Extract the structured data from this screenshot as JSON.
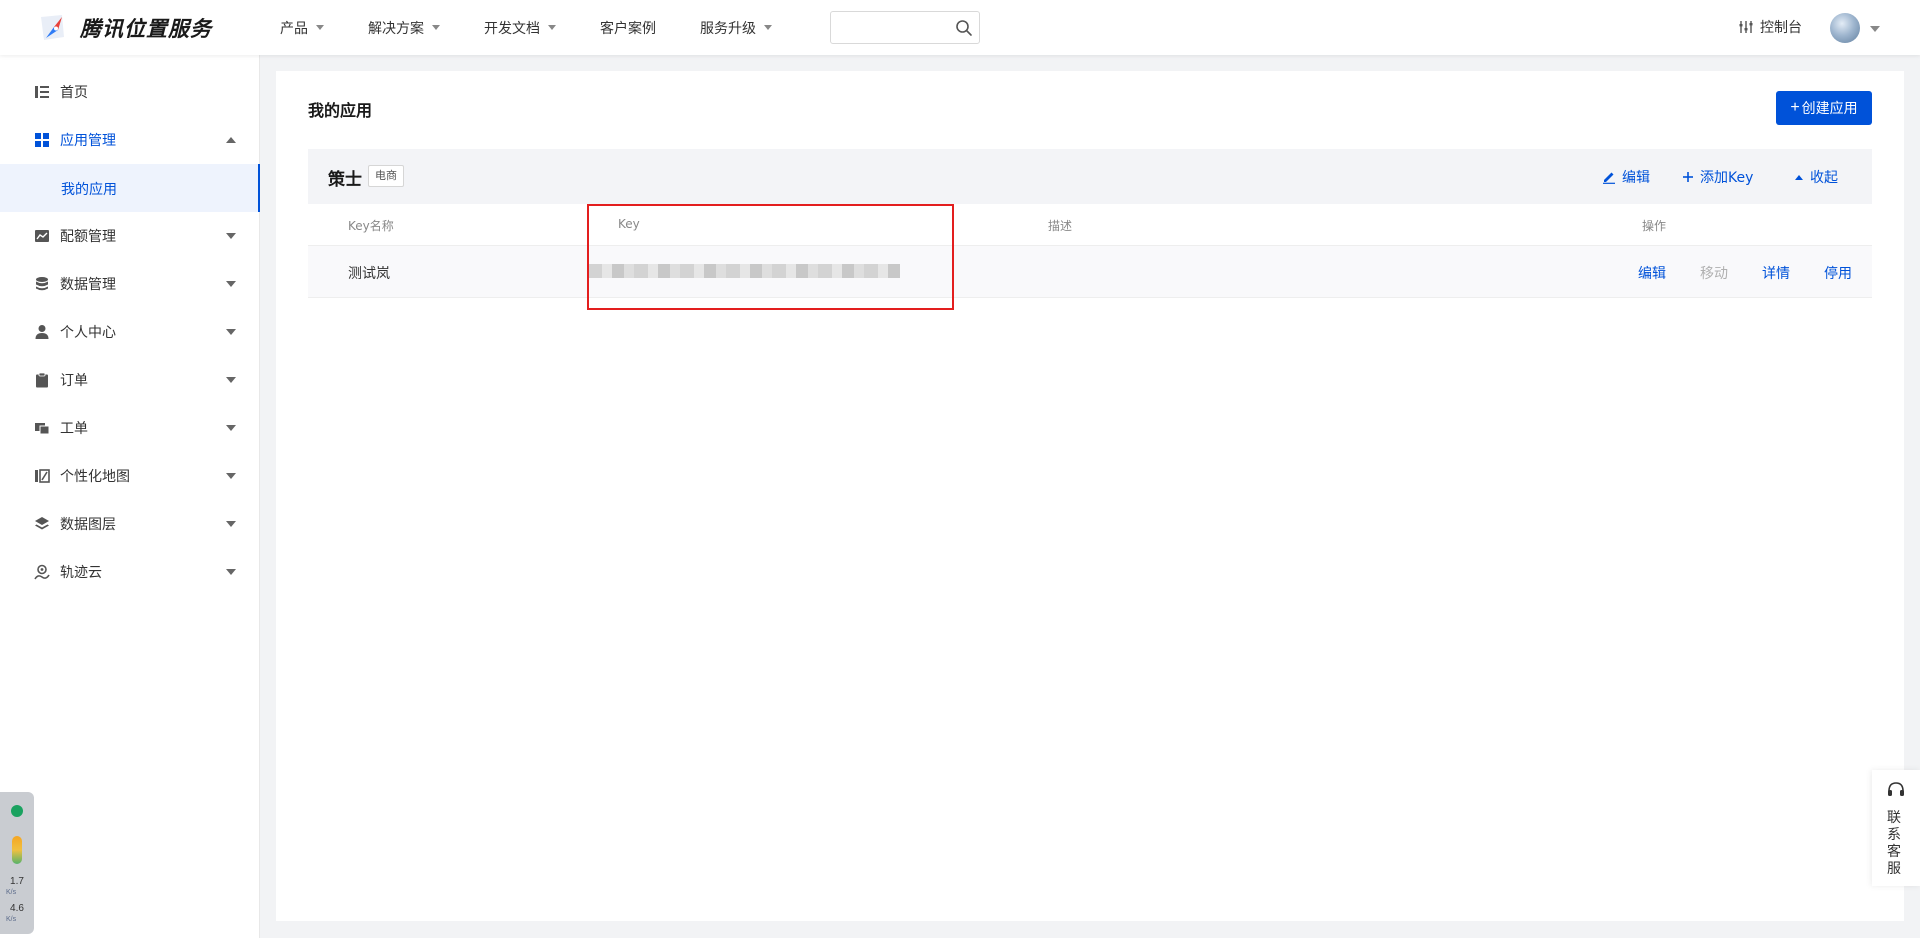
{
  "header": {
    "logo_text": "腾讯位置服务",
    "nav": [
      {
        "label": "产品",
        "has_caret": true
      },
      {
        "label": "解决方案",
        "has_caret": true
      },
      {
        "label": "开发文档",
        "has_caret": true
      },
      {
        "label": "客户案例",
        "has_caret": false
      },
      {
        "label": "服务升级",
        "has_caret": true
      }
    ],
    "search_value": "",
    "console_label": "控制台"
  },
  "sidebar": {
    "items": [
      {
        "label": "首页",
        "icon": "list-icon",
        "arrow": "none"
      },
      {
        "label": "应用管理",
        "icon": "grid-icon",
        "arrow": "up",
        "active": true
      },
      {
        "label": "配额管理",
        "icon": "chart-icon",
        "arrow": "down"
      },
      {
        "label": "数据管理",
        "icon": "database-icon",
        "arrow": "down"
      },
      {
        "label": "个人中心",
        "icon": "user-icon",
        "arrow": "down"
      },
      {
        "label": "订单",
        "icon": "clipboard-icon",
        "arrow": "down"
      },
      {
        "label": "工单",
        "icon": "ticket-icon",
        "arrow": "down"
      },
      {
        "label": "个性化地图",
        "icon": "map-style-icon",
        "arrow": "down"
      },
      {
        "label": "数据图层",
        "icon": "layers-icon",
        "arrow": "down"
      },
      {
        "label": "轨迹云",
        "icon": "track-icon",
        "arrow": "down"
      }
    ],
    "sub_item": "我的应用"
  },
  "main": {
    "title": "我的应用",
    "create_button": "创建应用",
    "app": {
      "name": "策士",
      "tag": "电商",
      "actions": {
        "edit": "编辑",
        "add_key": "添加Key",
        "collapse": "收起"
      }
    },
    "table": {
      "headers": {
        "name": "Key名称",
        "key": "Key",
        "desc": "描述",
        "ops": "操作"
      },
      "rows": [
        {
          "name": "测试岚",
          "key_blurred": true,
          "desc": "",
          "ops": [
            "编辑",
            "移动",
            "详情",
            "停用"
          ]
        }
      ]
    }
  },
  "monitor": {
    "val1": "1.7",
    "unit1": "K/s",
    "val2": "4.6",
    "unit2": "K/s"
  },
  "support": {
    "label": "联系客服"
  },
  "colors": {
    "primary": "#0052d9",
    "highlight": "#e31e1e",
    "disabled": "#b0b0b0"
  }
}
